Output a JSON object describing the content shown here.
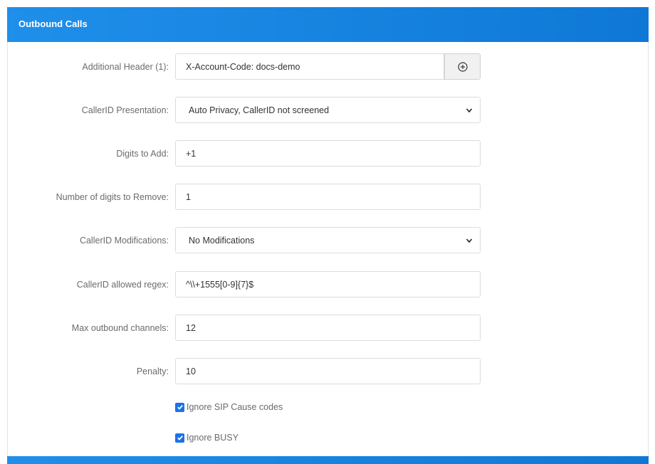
{
  "panel": {
    "title": "Outbound Calls"
  },
  "fields": {
    "additional_header": {
      "label": "Additional Header (1):",
      "value": "X-Account-Code: docs-demo"
    },
    "callerid_presentation": {
      "label": "CallerID Presentation:",
      "selected": "Auto Privacy, CallerID not screened"
    },
    "digits_to_add": {
      "label": "Digits to Add:",
      "value": "+1"
    },
    "digits_to_remove": {
      "label": "Number of digits to Remove:",
      "value": "1"
    },
    "callerid_modifications": {
      "label": "CallerID Modifications:",
      "selected": "No Modifications"
    },
    "callerid_regex": {
      "label": "CallerID allowed regex:",
      "value": "^\\\\+1555[0-9]{7}$"
    },
    "max_channels": {
      "label": "Max outbound channels:",
      "value": "12"
    },
    "penalty": {
      "label": "Penalty:",
      "value": "10"
    }
  },
  "checkboxes": {
    "ignore_sip_cause": {
      "label": "Ignore SIP Cause codes",
      "checked": true
    },
    "ignore_busy": {
      "label": "Ignore BUSY",
      "checked": true
    }
  },
  "icons": {
    "add_header": "plus-circle-icon",
    "caret": "chevron-down-icon",
    "check": "check-icon"
  },
  "colors": {
    "header_blue": "#1282e0",
    "checkbox_blue": "#1a73e8"
  }
}
